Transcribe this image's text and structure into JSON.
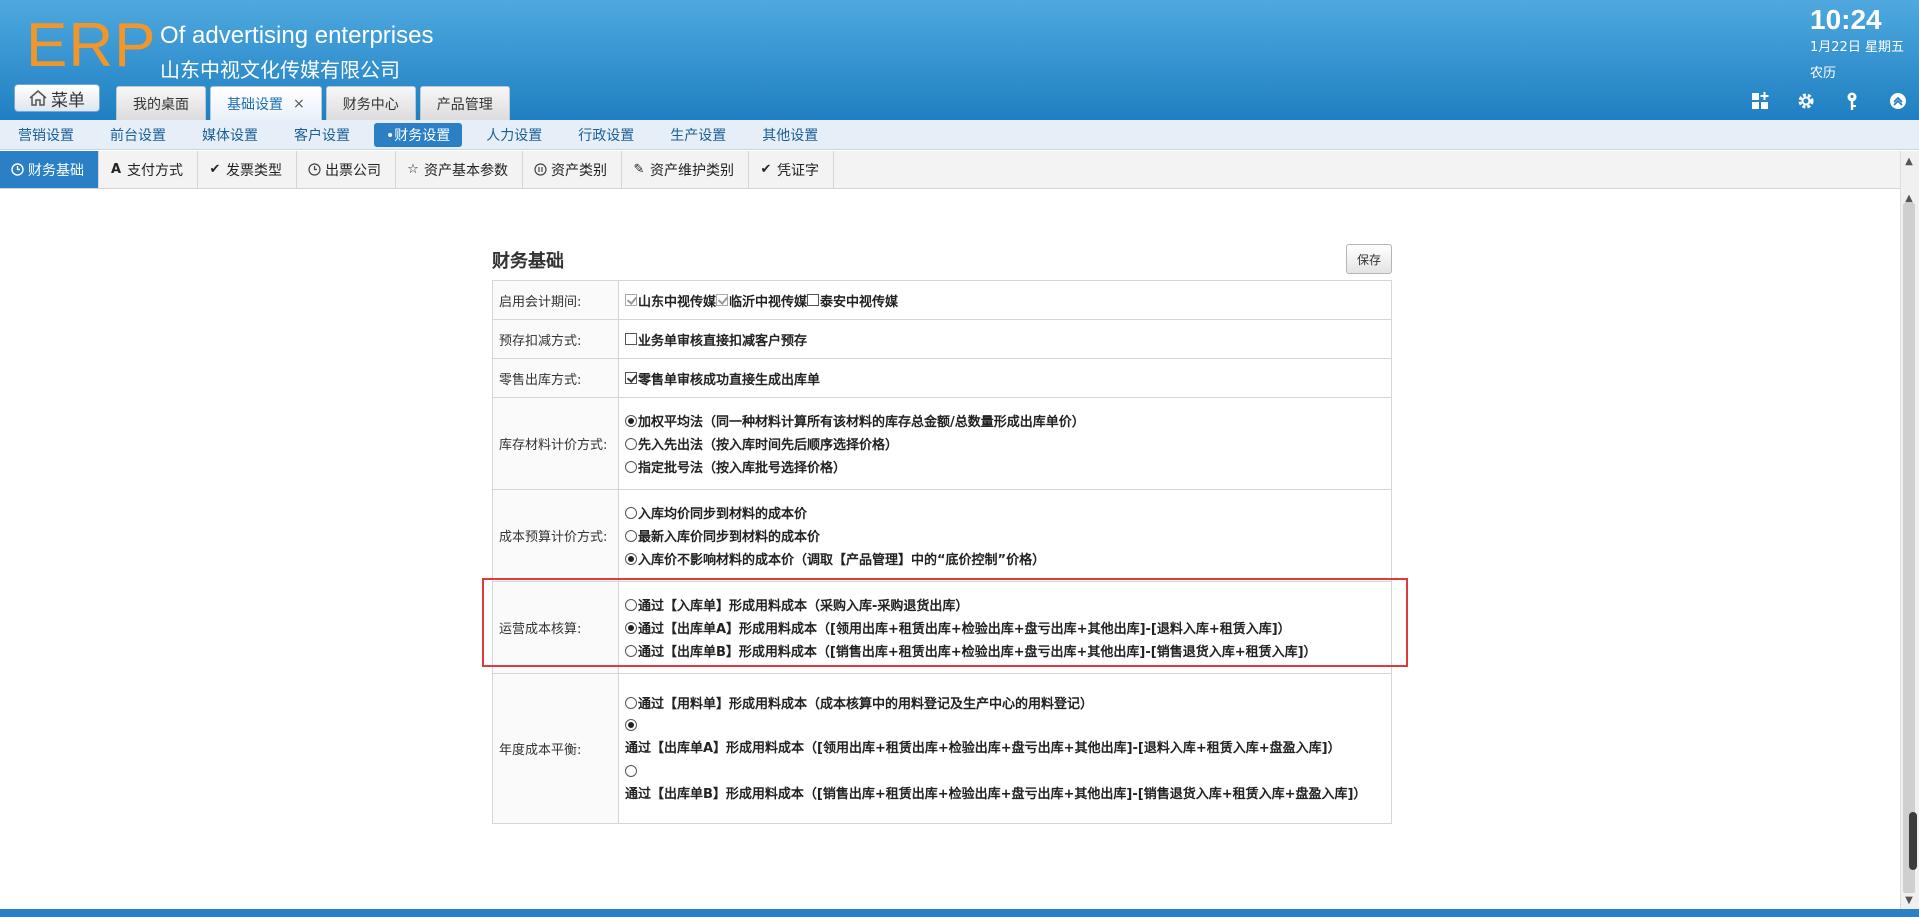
{
  "header": {
    "logo": "ERP",
    "company_en": "Of advertising enterprises",
    "company_cn": "山东中视文化传媒有限公司",
    "clock": "10:24",
    "date": "1月22日 星期五",
    "lunar": "农历",
    "menu_label": "菜单",
    "tabs": [
      {
        "label": "我的桌面"
      },
      {
        "label": "基础设置",
        "close": "×"
      },
      {
        "label": "财务中心"
      },
      {
        "label": "产品管理"
      }
    ],
    "icons": [
      "add-module-icon",
      "gear-icon",
      "key-icon",
      "collapse-up-icon"
    ]
  },
  "sub_nav": {
    "items": [
      "营销设置",
      "前台设置",
      "媒体设置",
      "客户设置",
      "•财务设置",
      "人力设置",
      "行政设置",
      "生产设置",
      "其他设置"
    ]
  },
  "tool_nav": {
    "items": [
      {
        "label": "财务基础",
        "icon": "clock-icon"
      },
      {
        "label": "支付方式",
        "icon": "letter-a-icon"
      },
      {
        "label": "发票类型",
        "icon": "check-icon"
      },
      {
        "label": "出票公司",
        "icon": "clock-icon"
      },
      {
        "label": "资产基本参数",
        "icon": "star-icon"
      },
      {
        "label": "资产类别",
        "icon": "pause-icon"
      },
      {
        "label": "资产维护类别",
        "icon": "pencil-icon"
      },
      {
        "label": "凭证字",
        "icon": "check-icon"
      }
    ]
  },
  "panel": {
    "title": "财务基础",
    "save_label": "保存",
    "rows": [
      {
        "label": "启用会计期间:",
        "options": [
          "山东中视传媒",
          "临沂中视传媒",
          "泰安中视传媒"
        ]
      },
      {
        "label": "预存扣减方式:",
        "options": [
          "业务单审核直接扣减客户预存"
        ]
      },
      {
        "label": "零售出库方式:",
        "options": [
          "零售单审核成功直接生成出库单"
        ]
      },
      {
        "label": "库存材料计价方式:",
        "options": [
          "加权平均法（同一种材料计算所有该材料的库存总金额/总数量形成出库单价）",
          "先入先出法（按入库时间先后顺序选择价格）",
          "指定批号法（按入库批号选择价格）"
        ]
      },
      {
        "label": "成本预算计价方式:",
        "options": [
          "入库均价同步到材料的成本价",
          "最新入库价同步到材料的成本价",
          "入库价不影响材料的成本价（调取【产品管理】中的“底价控制”价格）"
        ]
      },
      {
        "label": "运营成本核算:",
        "options": [
          "通过【入库单】形成用料成本（采购入库-采购退货出库）",
          "通过【出库单A】形成用料成本（[领用出库+租赁出库+检验出库+盘亏出库+其他出库]-[退料入库+租赁入库]）",
          "通过【出库单B】形成用料成本（[销售出库+租赁出库+检验出库+盘亏出库+其他出库]-[销售退货入库+租赁入库]）"
        ]
      },
      {
        "label": "年度成本平衡:",
        "options": [
          "通过【用料单】形成用料成本（成本核算中的用料登记及生产中心的用料登记）",
          "通过【出库单A】形成用料成本（[领用出库+租赁出库+检验出库+盘亏出库+其他出库]-[退料入库+租赁入库+盘盈入库]）",
          "通过【出库单B】形成用料成本（[销售出库+租赁出库+检验出库+盘亏出库+其他出库]-[销售退货入库+租赁入库+盘盈入库]）"
        ]
      }
    ]
  }
}
